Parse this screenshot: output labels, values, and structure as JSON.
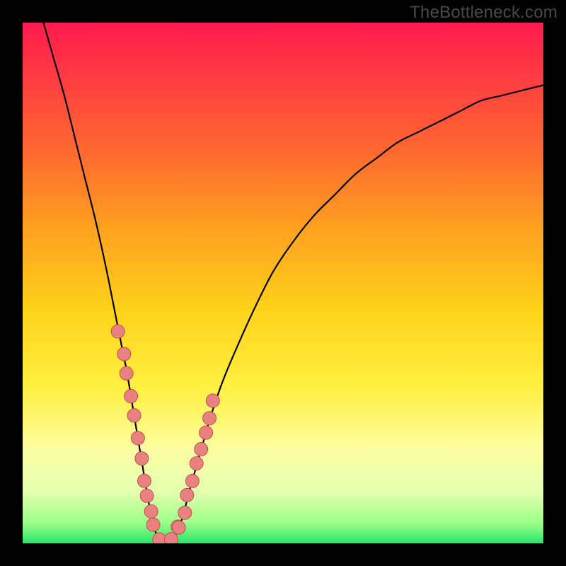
{
  "watermark": "TheBottleneck.com",
  "colors": {
    "background": "#000000",
    "curve": "#000000",
    "dot_fill": "#e98181",
    "dot_stroke": "#c54f4f",
    "gradient_stops": [
      {
        "offset": 0.0,
        "color": "#ff1a4f"
      },
      {
        "offset": 0.1,
        "color": "#ff3a42"
      },
      {
        "offset": 0.25,
        "color": "#ff6a2f"
      },
      {
        "offset": 0.4,
        "color": "#ffa21f"
      },
      {
        "offset": 0.55,
        "color": "#ffd21a"
      },
      {
        "offset": 0.7,
        "color": "#fff040"
      },
      {
        "offset": 0.82,
        "color": "#fdfea2"
      },
      {
        "offset": 0.9,
        "color": "#e4ffb0"
      },
      {
        "offset": 0.96,
        "color": "#9dff88"
      },
      {
        "offset": 1.0,
        "color": "#28e56a"
      }
    ]
  },
  "chart_data": {
    "type": "line",
    "title": "",
    "xlabel": "",
    "ylabel": "",
    "xlim": [
      0,
      100
    ],
    "ylim": [
      0,
      100
    ],
    "x": [
      4,
      6,
      8,
      10,
      12,
      14,
      16,
      18,
      19,
      20,
      21,
      22,
      23,
      24,
      25,
      26,
      27,
      28,
      29,
      30,
      31,
      32,
      34,
      36,
      38,
      40,
      44,
      48,
      52,
      56,
      60,
      64,
      68,
      72,
      76,
      80,
      84,
      88,
      92,
      96,
      100
    ],
    "values": [
      100,
      93,
      86,
      78,
      70,
      62,
      53,
      43,
      38,
      33,
      27,
      21,
      15,
      9,
      4,
      1,
      0,
      0,
      1,
      3,
      6,
      10,
      17,
      24,
      30,
      35,
      44,
      52,
      58,
      63,
      67,
      71,
      74,
      77,
      79,
      81,
      83,
      85,
      86,
      87,
      88
    ],
    "left_dots": {
      "x_range": [
        18.5,
        23.5
      ],
      "y_range": [
        8,
        40
      ],
      "count": 8
    },
    "right_dots": {
      "x_range": [
        30,
        37
      ],
      "y_range": [
        4,
        28
      ],
      "count": 9
    },
    "bottom_dots": {
      "x_range": [
        24,
        30
      ],
      "y_range": [
        0,
        3
      ],
      "count": 6
    }
  }
}
